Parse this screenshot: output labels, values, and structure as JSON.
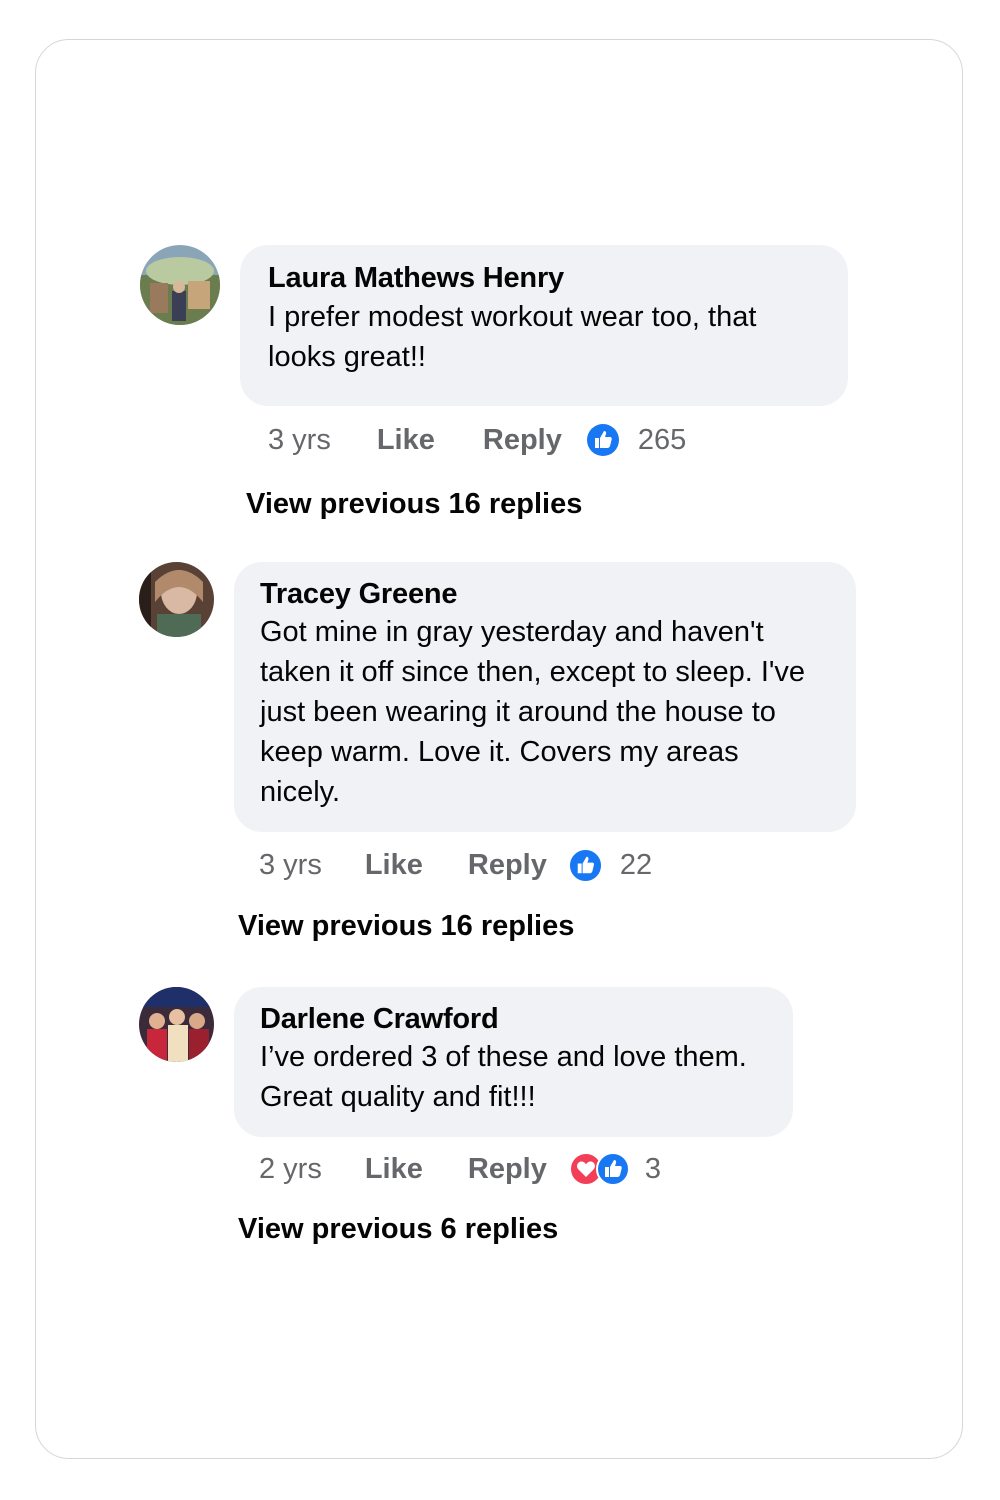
{
  "comments": [
    {
      "author": "Laura Mathews Henry",
      "text_line1": "I prefer modest workout wear too, that",
      "text_line2": "looks great!!",
      "time": "3 yrs",
      "like_label": "Like",
      "reply_label": "Reply",
      "reaction_count": "265",
      "view_replies": "View previous 16 replies"
    },
    {
      "author": "Tracey Greene",
      "text_line1": "Got mine in gray yesterday and haven't",
      "text_line2": "taken it off since then, except to sleep. I've",
      "text_line3": "just been wearing it around the house to",
      "text_line4": "keep warm. Love it. Covers my areas",
      "text_line5": "nicely.",
      "time": "3 yrs",
      "like_label": "Like",
      "reply_label": "Reply",
      "reaction_count": "22",
      "view_replies": "View previous 16 replies"
    },
    {
      "author": "Darlene Crawford",
      "text_line1": "I’ve ordered 3 of these and love them.",
      "text_line2": "Great quality and fit!!!",
      "time": "2 yrs",
      "like_label": "Like",
      "reply_label": "Reply",
      "reaction_count": "3",
      "view_replies": "View previous 6 replies"
    }
  ],
  "colors": {
    "like_blue": "#1877f2",
    "love_red": "#f33e58",
    "bubble_bg": "#f0f2f5",
    "meta_gray": "#65676b"
  },
  "icons": [
    "like-icon",
    "love-icon"
  ]
}
